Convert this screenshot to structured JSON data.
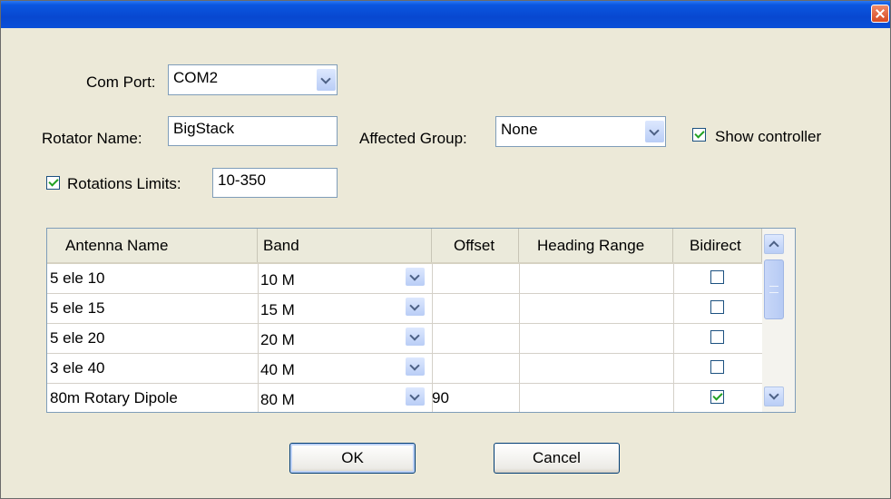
{
  "window": {
    "title": ""
  },
  "com_port": {
    "label": "Com Port:",
    "value": "COM2"
  },
  "rotator_name": {
    "label": "Rotator Name:",
    "value": "BigStack"
  },
  "affected_group": {
    "label": "Affected Group:",
    "value": "None"
  },
  "show_controller": {
    "label": "Show controller",
    "checked": true
  },
  "rotation_limits": {
    "label": "Rotations Limits:",
    "value": "10-350",
    "checked": true
  },
  "grid": {
    "columns": [
      "Antenna Name",
      "Band",
      "Offset",
      "Heading Range",
      "Bidirect"
    ],
    "rows": [
      {
        "name": "5 ele 10",
        "band": "10 M",
        "offset": "",
        "heading": "",
        "bidirect": false
      },
      {
        "name": "5 ele 15",
        "band": "15 M",
        "offset": "",
        "heading": "",
        "bidirect": false
      },
      {
        "name": "5 ele 20",
        "band": "20 M",
        "offset": "",
        "heading": "",
        "bidirect": false
      },
      {
        "name": "3 ele 40",
        "band": "40 M",
        "offset": "",
        "heading": "",
        "bidirect": false
      },
      {
        "name": "80m Rotary Dipole",
        "band": "80 M",
        "offset": "90",
        "heading": "",
        "bidirect": true
      }
    ]
  },
  "buttons": {
    "ok": "OK",
    "cancel": "Cancel"
  },
  "colors": {
    "titlebar": "#0848d0",
    "dialog_bg": "#ece9d8",
    "check_mark": "#21a121"
  }
}
